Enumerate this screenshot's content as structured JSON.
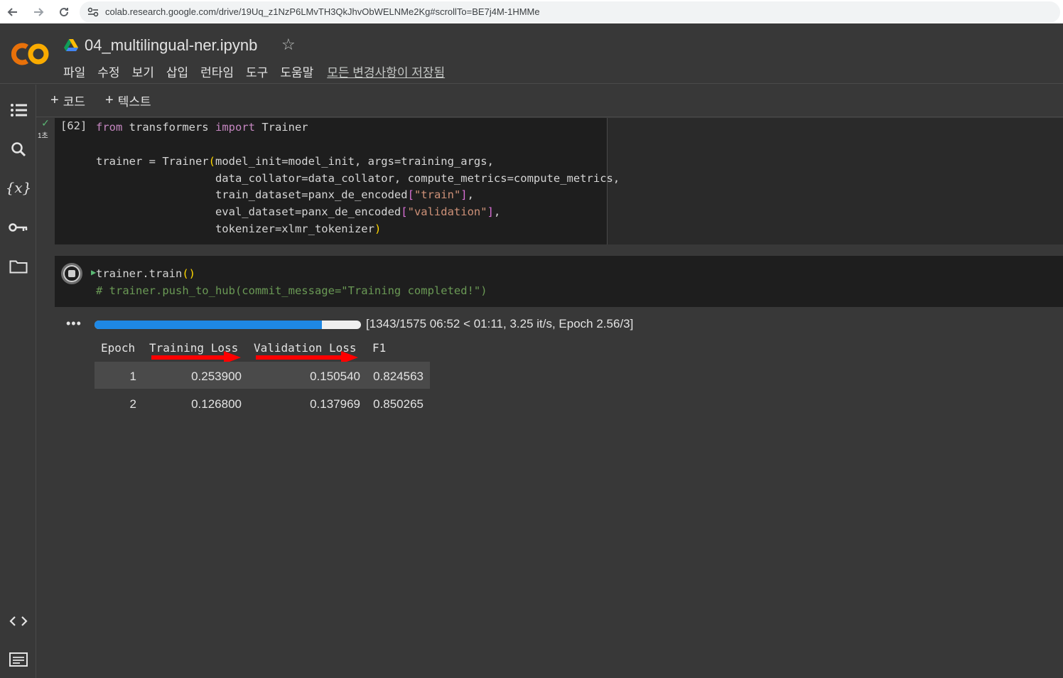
{
  "browser": {
    "url": "colab.research.google.com/drive/19Uq_z1NzP6LMvTH3QkJhvObWELNMe2Kg#scrollTo=BE7j4M-1HMMe"
  },
  "header": {
    "logo_text": "CO",
    "title": "04_multilingual-ner.ipynb",
    "menu": [
      "파일",
      "수정",
      "보기",
      "삽입",
      "런타임",
      "도구",
      "도움말"
    ],
    "saved_status": "모든 변경사항이 저장됨"
  },
  "toolbar": {
    "add_code": "코드",
    "add_text": "텍스트"
  },
  "cell1": {
    "exec_count": "[62]",
    "run_time": "1초",
    "line1": {
      "kw1": "from",
      "mid": " transformers ",
      "kw2": "import",
      "end": " Trainer"
    },
    "line2": {
      "start": "trainer = Trainer",
      "open": "(",
      "rest": "model_init=model_init, args=training_args,"
    },
    "line3": "                  data_collator=data_collator, compute_metrics=compute_metrics,",
    "line4": {
      "start": "                  train_dataset=panx_de_encoded",
      "open": "[",
      "str": "\"train\"",
      "close": "]",
      "end": ","
    },
    "line5": {
      "start": "                  eval_dataset=panx_de_encoded",
      "open": "[",
      "str": "\"validation\"",
      "close": "]",
      "end": ","
    },
    "line6": {
      "start": "                  tokenizer=xlmr_tokenizer",
      "close": ")"
    }
  },
  "cell2": {
    "line1": {
      "start": "trainer.train",
      "parens": "()"
    },
    "line2": "# trainer.push_to_hub(commit_message=\"Training completed!\")"
  },
  "output": {
    "more": "•••",
    "progress_fraction": 0.8527,
    "progress_text": "[1343/1575 06:52 < 01:11, 3.25 it/s, Epoch 2.56/3]",
    "headers": [
      "Epoch",
      "Training Loss",
      "Validation Loss",
      "F1"
    ],
    "rows": [
      [
        "1",
        "0.253900",
        "0.150540",
        "0.824563"
      ],
      [
        "2",
        "0.126800",
        "0.137969",
        "0.850265"
      ]
    ]
  },
  "colors": {
    "accent_orange": "#f9ab00",
    "progress_blue": "#1e88e5",
    "annotation_red": "#ff0000"
  }
}
